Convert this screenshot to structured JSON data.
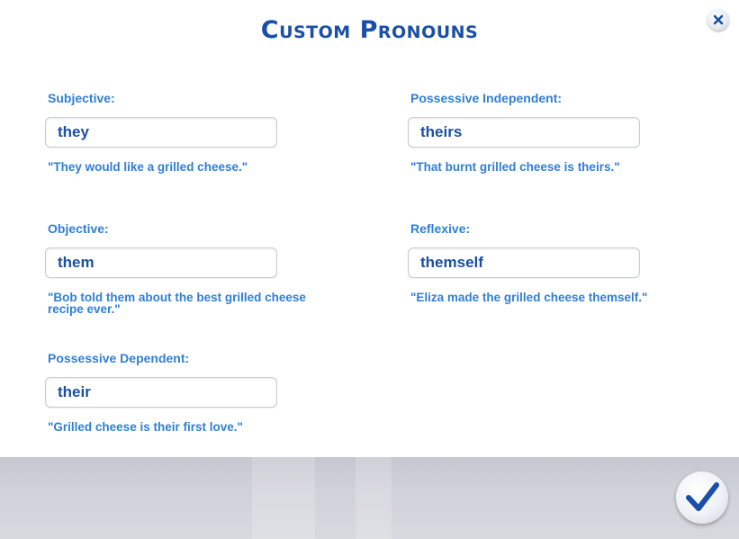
{
  "dialog": {
    "title": "Custom Pronouns"
  },
  "fields": {
    "subjective": {
      "label": "Subjective:",
      "value": "they",
      "example": "\"They would like a grilled cheese.\""
    },
    "objective": {
      "label": "Objective:",
      "value": "them",
      "example": "\"Bob told them about the best grilled cheese recipe ever.\""
    },
    "possessive_dependent": {
      "label": "Possessive Dependent:",
      "value": "their",
      "example": "\"Grilled cheese is their first love.\""
    },
    "possessive_independent": {
      "label": "Possessive Independent:",
      "value": "theirs",
      "example": "\"That burnt grilled cheese is theirs.\""
    },
    "reflexive": {
      "label": "Reflexive:",
      "value": "themself",
      "example": "\"Eliza made the grilled cheese themself.\""
    }
  },
  "icons": {
    "close": "close-icon",
    "confirm": "checkmark-icon"
  },
  "colors": {
    "title": "#1a4fa8",
    "label": "#2f7fd6",
    "input_text": "#1b4f9f",
    "footer": "#cdd0d7"
  }
}
